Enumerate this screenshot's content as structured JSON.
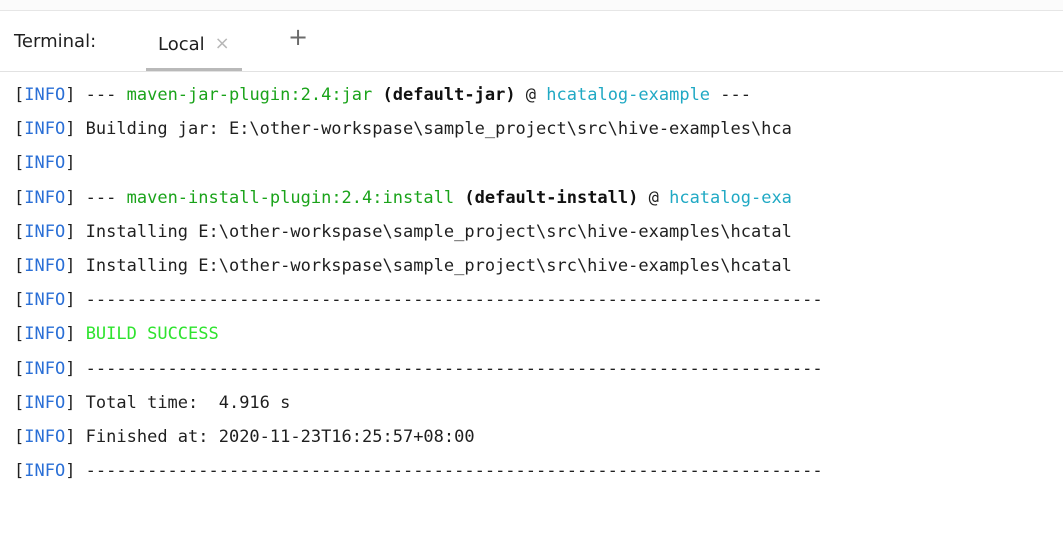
{
  "terminal": {
    "label": "Terminal:",
    "tab_label": "Local",
    "tab_close_icon": "close-icon",
    "new_tab_icon": "plus-icon",
    "new_tab_glyph": "+",
    "close_glyph": "×"
  },
  "colors": {
    "info_prefix": "#2a6fd6",
    "plugin_green": "#1aa31a",
    "build_success": "#2ee32e",
    "project_cyan": "#20a9c4",
    "text_default": "#1f1f1f"
  },
  "lines": [
    [
      {
        "text": "[",
        "style": "default"
      },
      {
        "text": "INFO",
        "style": "prefix"
      },
      {
        "text": "] --- ",
        "style": "default"
      },
      {
        "text": "maven-jar-plugin:2.4:jar",
        "style": "green"
      },
      {
        "text": " (default-jar)",
        "style": "bold"
      },
      {
        "text": " @ ",
        "style": "default"
      },
      {
        "text": "hcatalog-example",
        "style": "cyan"
      },
      {
        "text": " ---",
        "style": "default"
      }
    ],
    [
      {
        "text": "[",
        "style": "default"
      },
      {
        "text": "INFO",
        "style": "prefix"
      },
      {
        "text": "] Building jar: E:\\other-workspase\\sample_project\\src\\hive-examples\\hca",
        "style": "default"
      }
    ],
    [
      {
        "text": "[",
        "style": "default"
      },
      {
        "text": "INFO",
        "style": "prefix"
      },
      {
        "text": "]",
        "style": "default"
      }
    ],
    [
      {
        "text": "[",
        "style": "default"
      },
      {
        "text": "INFO",
        "style": "prefix"
      },
      {
        "text": "] --- ",
        "style": "default"
      },
      {
        "text": "maven-install-plugin:2.4:install",
        "style": "green"
      },
      {
        "text": " (default-install)",
        "style": "bold"
      },
      {
        "text": " @ ",
        "style": "default"
      },
      {
        "text": "hcatalog-exa",
        "style": "cyan"
      }
    ],
    [
      {
        "text": "[",
        "style": "default"
      },
      {
        "text": "INFO",
        "style": "prefix"
      },
      {
        "text": "] Installing E:\\other-workspase\\sample_project\\src\\hive-examples\\hcatal",
        "style": "default"
      }
    ],
    [
      {
        "text": "[",
        "style": "default"
      },
      {
        "text": "INFO",
        "style": "prefix"
      },
      {
        "text": "] Installing E:\\other-workspase\\sample_project\\src\\hive-examples\\hcatal",
        "style": "default"
      }
    ],
    [
      {
        "text": "[",
        "style": "default"
      },
      {
        "text": "INFO",
        "style": "prefix"
      },
      {
        "text": "] ------------------------------------------------------------------------",
        "style": "default"
      }
    ],
    [
      {
        "text": "[",
        "style": "default"
      },
      {
        "text": "INFO",
        "style": "prefix"
      },
      {
        "text": "] ",
        "style": "default"
      },
      {
        "text": "BUILD SUCCESS",
        "style": "success"
      }
    ],
    [
      {
        "text": "[",
        "style": "default"
      },
      {
        "text": "INFO",
        "style": "prefix"
      },
      {
        "text": "] ------------------------------------------------------------------------",
        "style": "default"
      }
    ],
    [
      {
        "text": "[",
        "style": "default"
      },
      {
        "text": "INFO",
        "style": "prefix"
      },
      {
        "text": "] Total time:  4.916 s",
        "style": "default"
      }
    ],
    [
      {
        "text": "[",
        "style": "default"
      },
      {
        "text": "INFO",
        "style": "prefix"
      },
      {
        "text": "] Finished at: 2020-11-23T16:25:57+08:00",
        "style": "default"
      }
    ],
    [
      {
        "text": "[",
        "style": "default"
      },
      {
        "text": "INFO",
        "style": "prefix"
      },
      {
        "text": "] ------------------------------------------------------------------------",
        "style": "default"
      }
    ]
  ]
}
